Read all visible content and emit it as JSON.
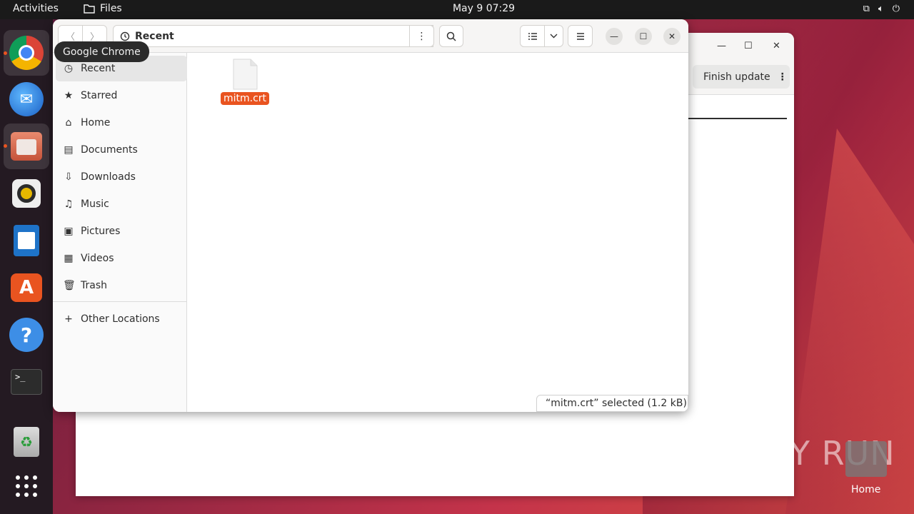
{
  "topbar": {
    "activities": "Activities",
    "app_name": "Files",
    "clock": "May 9  07:29"
  },
  "tooltip": "Google Chrome",
  "dock": {
    "items": [
      "chrome-icon",
      "thunderbird-icon",
      "files-icon",
      "rhythmbox-icon",
      "writer-icon",
      "app-center-icon",
      "help-icon",
      "terminal-icon",
      "trash-icon",
      "app-grid-icon"
    ]
  },
  "background_window": {
    "finish_button": "Finish update"
  },
  "files": {
    "location": "Recent",
    "sidebar": [
      {
        "label": "Recent",
        "icon": "clock-icon"
      },
      {
        "label": "Starred",
        "icon": "star-icon"
      },
      {
        "label": "Home",
        "icon": "home-icon"
      },
      {
        "label": "Documents",
        "icon": "document-icon"
      },
      {
        "label": "Downloads",
        "icon": "download-icon"
      },
      {
        "label": "Music",
        "icon": "music-icon"
      },
      {
        "label": "Pictures",
        "icon": "picture-icon"
      },
      {
        "label": "Videos",
        "icon": "video-icon"
      },
      {
        "label": "Trash",
        "icon": "trash-icon"
      }
    ],
    "other_locations": "Other Locations",
    "file": {
      "name": "mitm.crt"
    },
    "status": "“mitm.crt” selected  (1.2 kB)"
  },
  "watermark": "ANY RUN",
  "desktop_home_label": "Home",
  "colors": {
    "accent": "#e95420",
    "topbar": "#1a1a1a",
    "dock": "#241a22"
  }
}
